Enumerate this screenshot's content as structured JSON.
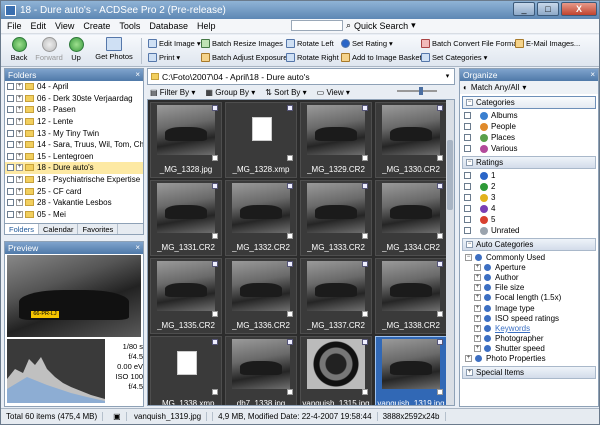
{
  "window": {
    "title": "18 - Dure auto's - ACDSee Pro 2 (Pre-release)",
    "controls": {
      "minimize": "_",
      "maximize": "□",
      "close": "X"
    }
  },
  "menu": [
    "File",
    "Edit",
    "View",
    "Create",
    "Tools",
    "Database",
    "Help"
  ],
  "quick_search": {
    "label": "Quick Search"
  },
  "toolbar": {
    "back": "Back",
    "forward": "Forward",
    "up": "Up",
    "get_photos": "Get Photos",
    "edit_image": "Edit Image",
    "print": "Print",
    "rotate_left": "Rotate Left",
    "rotate_right": "Rotate Right",
    "batch_resize": "Batch Resize Images",
    "batch_adjust": "Batch Adjust Exposure",
    "set_rating": "Set Rating",
    "add_basket": "Add to Image Basket",
    "batch_convert": "Batch Convert File Format",
    "set_categories": "Set Categories",
    "email": "E-Mail Images..."
  },
  "folders": {
    "title": "Folders",
    "items": [
      "04 - April",
      "06 - Derk 30ste Verjaardag",
      "08 - Pasen",
      "12 - Lente",
      "13 - My Tiny Twin",
      "14 - Sara, Truus, Wil, Tom, Ch",
      "15 - Lentegroen",
      "18 - Dure auto's",
      "18 - Psychiatrische Expertise",
      "25 - CF card",
      "28 - Vakantie Lesbos",
      "05 - Mei"
    ],
    "selected": "18 - Dure auto's",
    "tabs": [
      "Folders",
      "Calendar",
      "Favorites"
    ]
  },
  "preview": {
    "title": "Preview",
    "plate": "66-PR-LJ",
    "shutter": "1/80 s",
    "aperture": "f/4.5",
    "ev": "0.00 eV",
    "iso": "ISO 100",
    "focal": "f/4.5"
  },
  "path": "C:\\Foto\\2007\\04 - April\\18 - Dure auto's",
  "filterbar": {
    "filter": "Filter By",
    "group": "Group By",
    "sort": "Sort By",
    "view": "View"
  },
  "thumbnails": [
    {
      "name": "_MG_1328.jpg",
      "kind": "photo"
    },
    {
      "name": "_MG_1328.xmp",
      "kind": "file"
    },
    {
      "name": "_MG_1329.CR2",
      "kind": "photo"
    },
    {
      "name": "_MG_1330.CR2",
      "kind": "photo"
    },
    {
      "name": "_MG_1331.CR2",
      "kind": "photo"
    },
    {
      "name": "_MG_1332.CR2",
      "kind": "photo"
    },
    {
      "name": "_MG_1333.CR2",
      "kind": "photo"
    },
    {
      "name": "_MG_1334.CR2",
      "kind": "photo"
    },
    {
      "name": "_MG_1335.CR2",
      "kind": "photo"
    },
    {
      "name": "_MG_1336.CR2",
      "kind": "photo"
    },
    {
      "name": "_MG_1337.CR2",
      "kind": "photo"
    },
    {
      "name": "_MG_1338.CR2",
      "kind": "photo"
    },
    {
      "name": "_MG_1338.xmp",
      "kind": "file"
    },
    {
      "name": "db7_1338.jpg",
      "kind": "photo"
    },
    {
      "name": "vanquish_1315.jpg",
      "kind": "wheel"
    },
    {
      "name": "vanquish_1319.jpg",
      "kind": "photo",
      "selected": true
    }
  ],
  "organize": {
    "title": "Organize",
    "match": "Match Any/All",
    "categories_header": "Categories",
    "categories": [
      "Albums",
      "People",
      "Places",
      "Various"
    ],
    "ratings_header": "Ratings",
    "ratings": [
      "1",
      "2",
      "3",
      "4",
      "5",
      "Unrated"
    ],
    "auto_header": "Auto Categories",
    "common": "Commonly Used",
    "auto_items": [
      "Aperture",
      "Author",
      "File size",
      "Focal length (1.5x)",
      "Image type",
      "ISO speed ratings",
      "Keywords",
      "Photographer",
      "Shutter speed"
    ],
    "photo_props": "Photo Properties",
    "special": "Special Items"
  },
  "status": {
    "total": "Total 60 items  (475,4 MB)",
    "file": "vanquish_1319.jpg",
    "info": "4,9 MB, Modified Date: 22-4-2007 19:58:44",
    "dims": "3888x2592x24b"
  },
  "colors": {
    "accent": "#3168b5",
    "rating_colors": [
      "#2a66c8",
      "#2e9a37",
      "#e2b21c",
      "#7a3fb4",
      "#d8402f",
      "#9aa3ad"
    ]
  }
}
